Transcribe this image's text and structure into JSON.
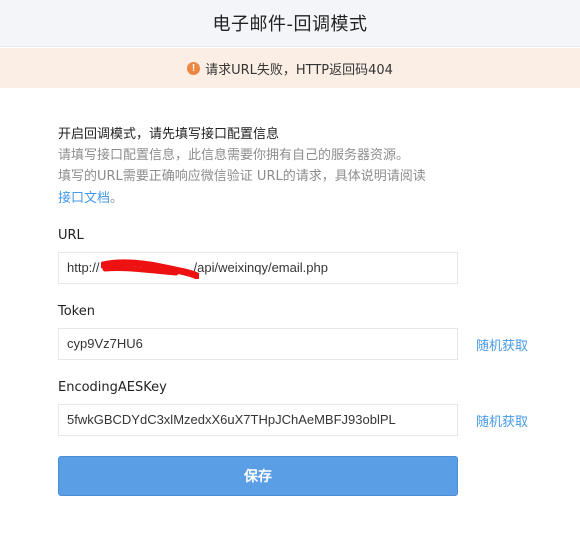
{
  "header": {
    "title": "电子邮件-回调模式"
  },
  "error": {
    "icon": "warning-icon",
    "text": "请求URL失败，HTTP返回码404",
    "color": "#ec8743"
  },
  "intro": {
    "title": "开启回调模式，请先填写接口配置信息",
    "desc_line1": "请填写接口配置信息，此信息需要你拥有自己的服务器资源。",
    "desc_line2": "填写的URL需要正确响应微信验证 URL的请求，具体说明请阅读",
    "link": "接口文档",
    "tail": "。"
  },
  "fields": {
    "url": {
      "label": "URL",
      "value_prefix": "http://",
      "value_suffix": "/api/weixinqy/email.php"
    },
    "token": {
      "label": "Token",
      "value": "cyp9Vz7HU6",
      "random": "随机获取"
    },
    "aeskey": {
      "label": "EncodingAESKey",
      "value": "5fwkGBCDYdC3xlMzedxX6uX7THpJChAeMBFJ93oblPL",
      "random": "随机获取"
    }
  },
  "save_button": "保存"
}
